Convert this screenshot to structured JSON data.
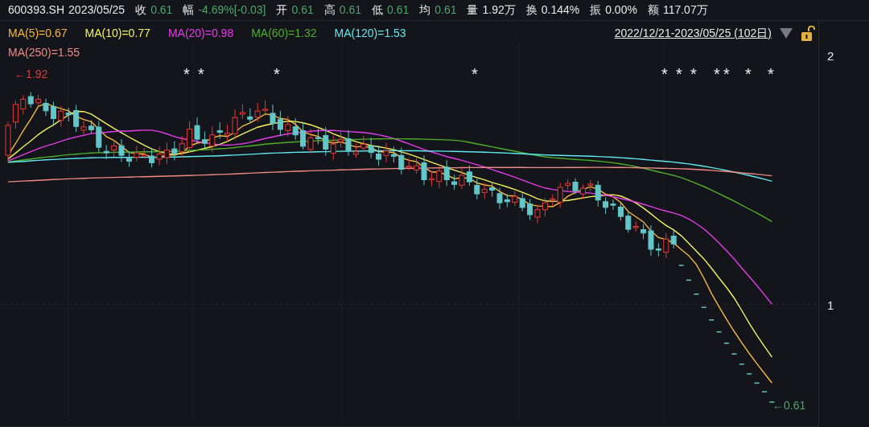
{
  "quote": {
    "symbol": "600393.SH",
    "date": "2023/05/25",
    "fields": [
      {
        "label": "收",
        "value": "0.61",
        "kind": "down"
      },
      {
        "label": "幅",
        "value": "-4.69%[-0.03]",
        "kind": "down"
      },
      {
        "label": "开",
        "value": "0.61",
        "kind": "down"
      },
      {
        "label": "高",
        "value": "0.61",
        "kind": "down"
      },
      {
        "label": "低",
        "value": "0.61",
        "kind": "down"
      },
      {
        "label": "均",
        "value": "0.61",
        "kind": "down"
      },
      {
        "label": "量",
        "value": "1.92万",
        "kind": "plain"
      },
      {
        "label": "换",
        "value": "0.144%",
        "kind": "plain"
      },
      {
        "label": "振",
        "value": "0.00%",
        "kind": "plain"
      },
      {
        "label": "额",
        "value": "117.07万",
        "kind": "plain"
      }
    ]
  },
  "ma_legend": [
    {
      "label": "MA(5)=0.67",
      "color": "#f5b83d"
    },
    {
      "label": "MA(10)=0.77",
      "color": "#f4f25c"
    },
    {
      "label": "MA(20)=0.98",
      "color": "#e33ce8"
    },
    {
      "label": "MA(60)=1.32",
      "color": "#4cae2c"
    },
    {
      "label": "MA(120)=1.53",
      "color": "#5ee8f0"
    },
    {
      "label": "MA(250)=1.55",
      "color": "#f08a84"
    }
  ],
  "range": {
    "label": "2022/12/21-2023/05/25 (102日)",
    "locked": false
  },
  "chart": {
    "high_label": "←1.92",
    "low_label": "←0.61",
    "markers": [
      "*",
      "*",
      "*",
      "*",
      "*",
      "*",
      "*",
      "*",
      "*",
      "*",
      "*"
    ],
    "y_axis": [
      "2",
      "1"
    ]
  }
}
